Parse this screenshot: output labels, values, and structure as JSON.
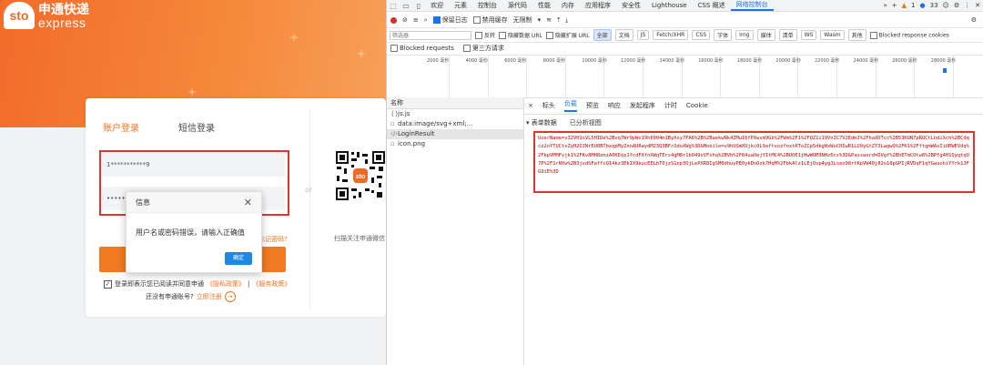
{
  "login": {
    "logo_mark": "sto",
    "logo_cn": "申通快递",
    "logo_en": "express",
    "tab_account": "账户登录",
    "tab_sms": "短信登录",
    "username_value": "1***********9",
    "password_value": "•••••",
    "or_label": "or",
    "qr_caption": "扫描关注申通微信",
    "forgot": "忘记密码?",
    "agree_text": "登录即表示您已阅读并同意申通",
    "privacy": "《隐私政策》",
    "sep": "|",
    "service": "《服务政策》",
    "no_account": "还没有申通账号?",
    "register": "立即注册"
  },
  "dialog": {
    "title": "信息",
    "message": "用户名或密码错误，请输入正确值",
    "ok": "确定"
  },
  "devtools": {
    "tabs": [
      "欢迎",
      "元素",
      "控制台",
      "源代码",
      "性能",
      "内存",
      "应用程序",
      "安全性",
      "Lighthouse",
      "CSS 概述",
      "网络控制台"
    ],
    "active_tab": "网络控制台",
    "warn_count": "1",
    "info_count": "33",
    "toolbar": {
      "preserve_log": "保留日志",
      "disable_cache": "禁用缓存",
      "throttle": "无限制"
    },
    "filter": {
      "placeholder": "筛选器",
      "invert": "反转",
      "hide_data_url": "隐藏数据 URL",
      "hide_ext_url": "隐藏扩展 URL",
      "types": [
        "全部",
        "文档",
        "JS",
        "Fetch/XHR",
        "CSS",
        "字体",
        "Img",
        "媒体",
        "清单",
        "WS",
        "Wasm",
        "其他"
      ],
      "blocked_cookies": "Blocked response cookies"
    },
    "blocked_requests": "Blocked requests",
    "third_party": "第三方请求",
    "ticks": [
      "2000 毫秒",
      "4000 毫秒",
      "6000 毫秒",
      "8000 毫秒",
      "10000 毫秒",
      "12000 毫秒",
      "14000 毫秒",
      "16000 毫秒",
      "18000 毫秒",
      "20000 毫秒",
      "22000 毫秒",
      "24000 毫秒",
      "26000 毫秒",
      "28000 毫秒"
    ],
    "name_header": "名称",
    "requests": [
      {
        "icon": "{}",
        "name": "js.js"
      },
      {
        "icon": "▫",
        "name": "data:image/svg+xml;..."
      },
      {
        "icon": "‹/›",
        "name": "LoginResult"
      },
      {
        "icon": "▫",
        "name": "icon.png"
      }
    ],
    "detail_tabs": [
      "×",
      "标头",
      "负载",
      "预览",
      "响应",
      "发起程序",
      "计时",
      "Cookie"
    ],
    "detail_active": "负载",
    "form_data": "▾ 表单数据",
    "parsed_view": "已分析视图",
    "payload": "UserName=v32VH1sVL5HIDe%2Bvq7Wr9pWx19h6004m1ByXxy7PA6%2B%2BaekwNk4ZMuI6fPXwvm9Gb%2FWm%2F1%2FQZ1i19VnIC7V2EdmJ%2FhaXDTcc%2B53KUN7pRQCtLhdiXch%2BCdqcz2oYTUCtxZyH2OJNrEUOBTbxqpMyZnnAURaydM23Q3BFcOdoXWg%3D&Mobile=v9hUQmXUjkcOL9aftvozfnxtRToZCp5dkgNxWuC0IwR1LU9yGtZY3LwgwQ%2FK1%2FftgmWAvIiORWEVdq%2FkpVMHFvjk1%2FKv8MH8zmiA0KDip1fcdFXfnXWqTErs4gM8r1bO49xVFxhq%2BVb%2F84uaUejYItMC4%2BUOE1jHwWOM3NHz6cs%3D&Password=DVgf%2BhETmCOtw8%2BPfg4H1QyqtqU7P%2F1rNYw%2B3jvdSFaffcQI4kz3EkIX9eucEELbT0jzS1np3OjLePXR8IgSM0dhuyPE0ykDnOzk7HqM%2FbkAlz1LEjOsp4ygJLseo98rtKpVW40j82o18pGPIjRVDqF1qYGwuohiYYrk1JFG9iE%3D"
  }
}
